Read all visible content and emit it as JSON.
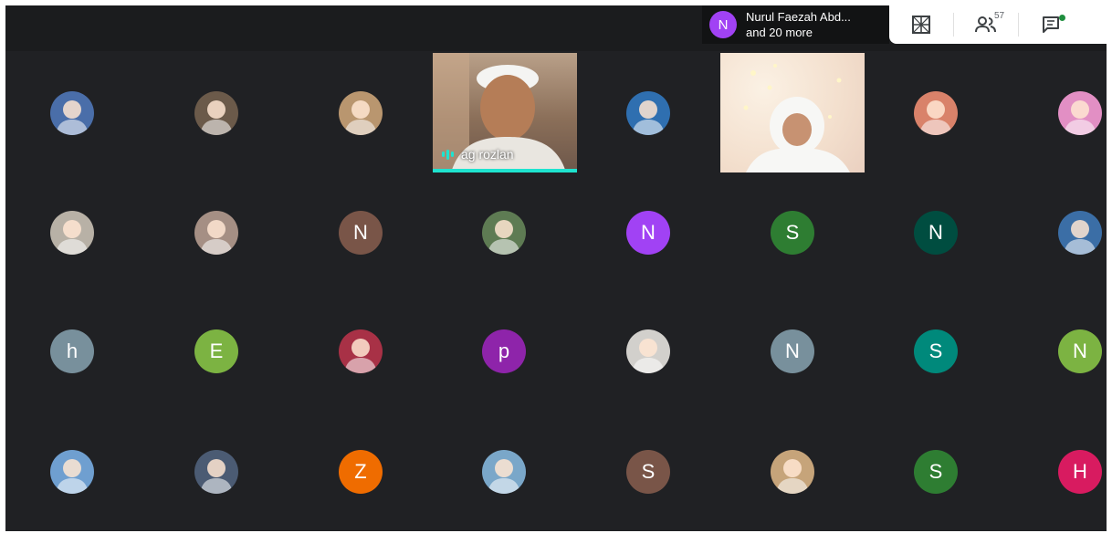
{
  "notification": {
    "initial": "N",
    "line1": "Nurul Faezah Abd...",
    "line2": "and 20 more",
    "avatar_color": "#a142f4"
  },
  "toolbar": {
    "participant_count": "57"
  },
  "colors": {
    "background": "#202124",
    "speaking_accent": "#1ee3cf"
  },
  "videos": [
    {
      "name": "ag rozlan"
    }
  ],
  "participants": [
    {
      "type": "photo",
      "color": "#4a6ea9"
    },
    {
      "type": "photo",
      "color": "#6b5a4a"
    },
    {
      "type": "photo",
      "color": "#b9966f"
    },
    {
      "type": "video"
    },
    {
      "type": "photo",
      "color": "#2f6fb0"
    },
    {
      "type": "video"
    },
    {
      "type": "photo",
      "color": "#d9826a"
    },
    {
      "type": "photo",
      "color": "#e28fc4"
    },
    {
      "type": "photo",
      "color": "#b8b1a6"
    },
    {
      "type": "photo",
      "color": "#a58f84"
    },
    {
      "type": "letter",
      "letter": "N",
      "color": "#795548"
    },
    {
      "type": "photo",
      "color": "#5e7b53"
    },
    {
      "type": "letter",
      "letter": "N",
      "color": "#a142f4"
    },
    {
      "type": "letter",
      "letter": "S",
      "color": "#2e7d32"
    },
    {
      "type": "letter",
      "letter": "N",
      "color": "#004d40"
    },
    {
      "type": "photo",
      "color": "#3b6ea6"
    },
    {
      "type": "letter",
      "letter": "h",
      "color": "#78909c"
    },
    {
      "type": "letter",
      "letter": "E",
      "color": "#7cb342"
    },
    {
      "type": "photo",
      "color": "#a83146"
    },
    {
      "type": "letter",
      "letter": "p",
      "color": "#8e24aa"
    },
    {
      "type": "photo",
      "color": "#d2d0cc"
    },
    {
      "type": "letter",
      "letter": "N",
      "color": "#78909c"
    },
    {
      "type": "letter",
      "letter": "S",
      "color": "#00897b"
    },
    {
      "type": "letter",
      "letter": "N",
      "color": "#7cb342"
    },
    {
      "type": "photo",
      "color": "#6f9fd0"
    },
    {
      "type": "photo",
      "color": "#4b5b73"
    },
    {
      "type": "letter",
      "letter": "Z",
      "color": "#ef6c00"
    },
    {
      "type": "photo",
      "color": "#7aa7c9"
    },
    {
      "type": "letter",
      "letter": "S",
      "color": "#795548"
    },
    {
      "type": "photo",
      "color": "#c6a47a"
    },
    {
      "type": "letter",
      "letter": "S",
      "color": "#2e7d32"
    },
    {
      "type": "letter",
      "letter": "H",
      "color": "#d81b60"
    }
  ]
}
